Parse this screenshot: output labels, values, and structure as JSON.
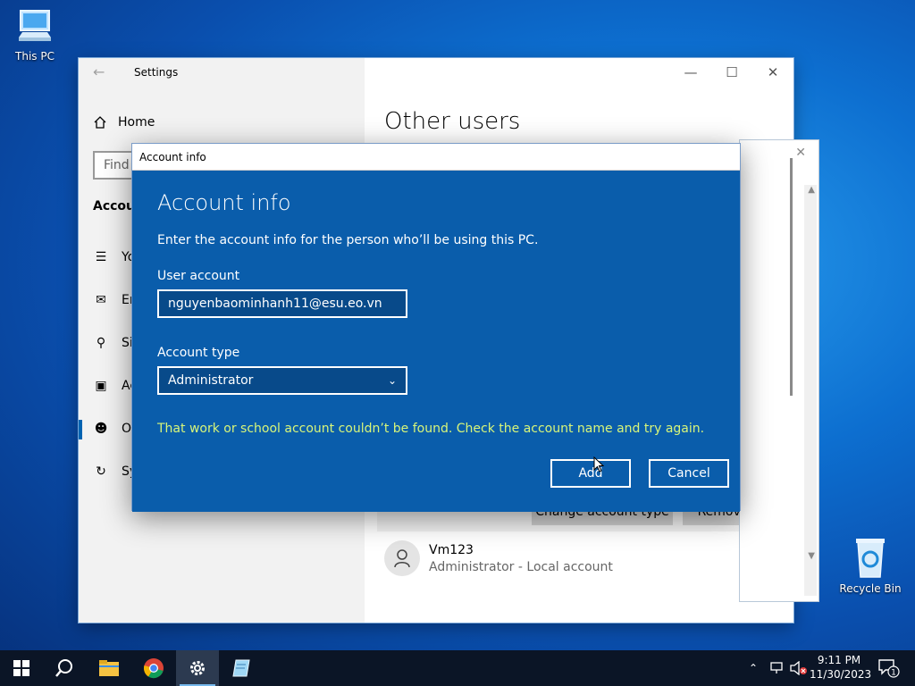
{
  "desktop": {
    "this_pc_label": "This PC",
    "recycle_bin_label": "Recycle Bin"
  },
  "settings": {
    "title": "Settings",
    "home_label": "Home",
    "search_placeholder": "Find",
    "section_label": "Accou",
    "nav_items": [
      {
        "label": "Yo",
        "icon": "person-card-icon"
      },
      {
        "label": "En",
        "icon": "mail-icon"
      },
      {
        "label": "Si",
        "icon": "key-icon"
      },
      {
        "label": "Ac",
        "icon": "briefcase-icon"
      },
      {
        "label": "Ot",
        "icon": "person-add-icon"
      },
      {
        "label": "Sy",
        "icon": "sync-icon"
      }
    ],
    "page_heading": "Other users",
    "change_account_type_label": "Change account type",
    "remove_label": "Remove",
    "user": {
      "name": "Vm123",
      "subtitle": "Administrator - Local account"
    }
  },
  "dialog": {
    "window_title": "Account info",
    "heading": "Account info",
    "description": "Enter the account info for the person who’ll be using this PC.",
    "user_account_label": "User account",
    "user_account_value": "nguyenbaominhanh11@esu.eo.vn",
    "account_type_label": "Account type",
    "account_type_value": "Administrator",
    "error_message": "That work or school account couldn’t be found. Check the account name and try again.",
    "add_label": "Add",
    "cancel_label": "Cancel"
  },
  "taskbar": {
    "time": "9:11 PM",
    "date": "11/30/2023",
    "notification_count": "1"
  },
  "colors": {
    "dialog_bg": "#0a5dab",
    "error_text": "#d7f57a",
    "accent": "#0063b1"
  }
}
